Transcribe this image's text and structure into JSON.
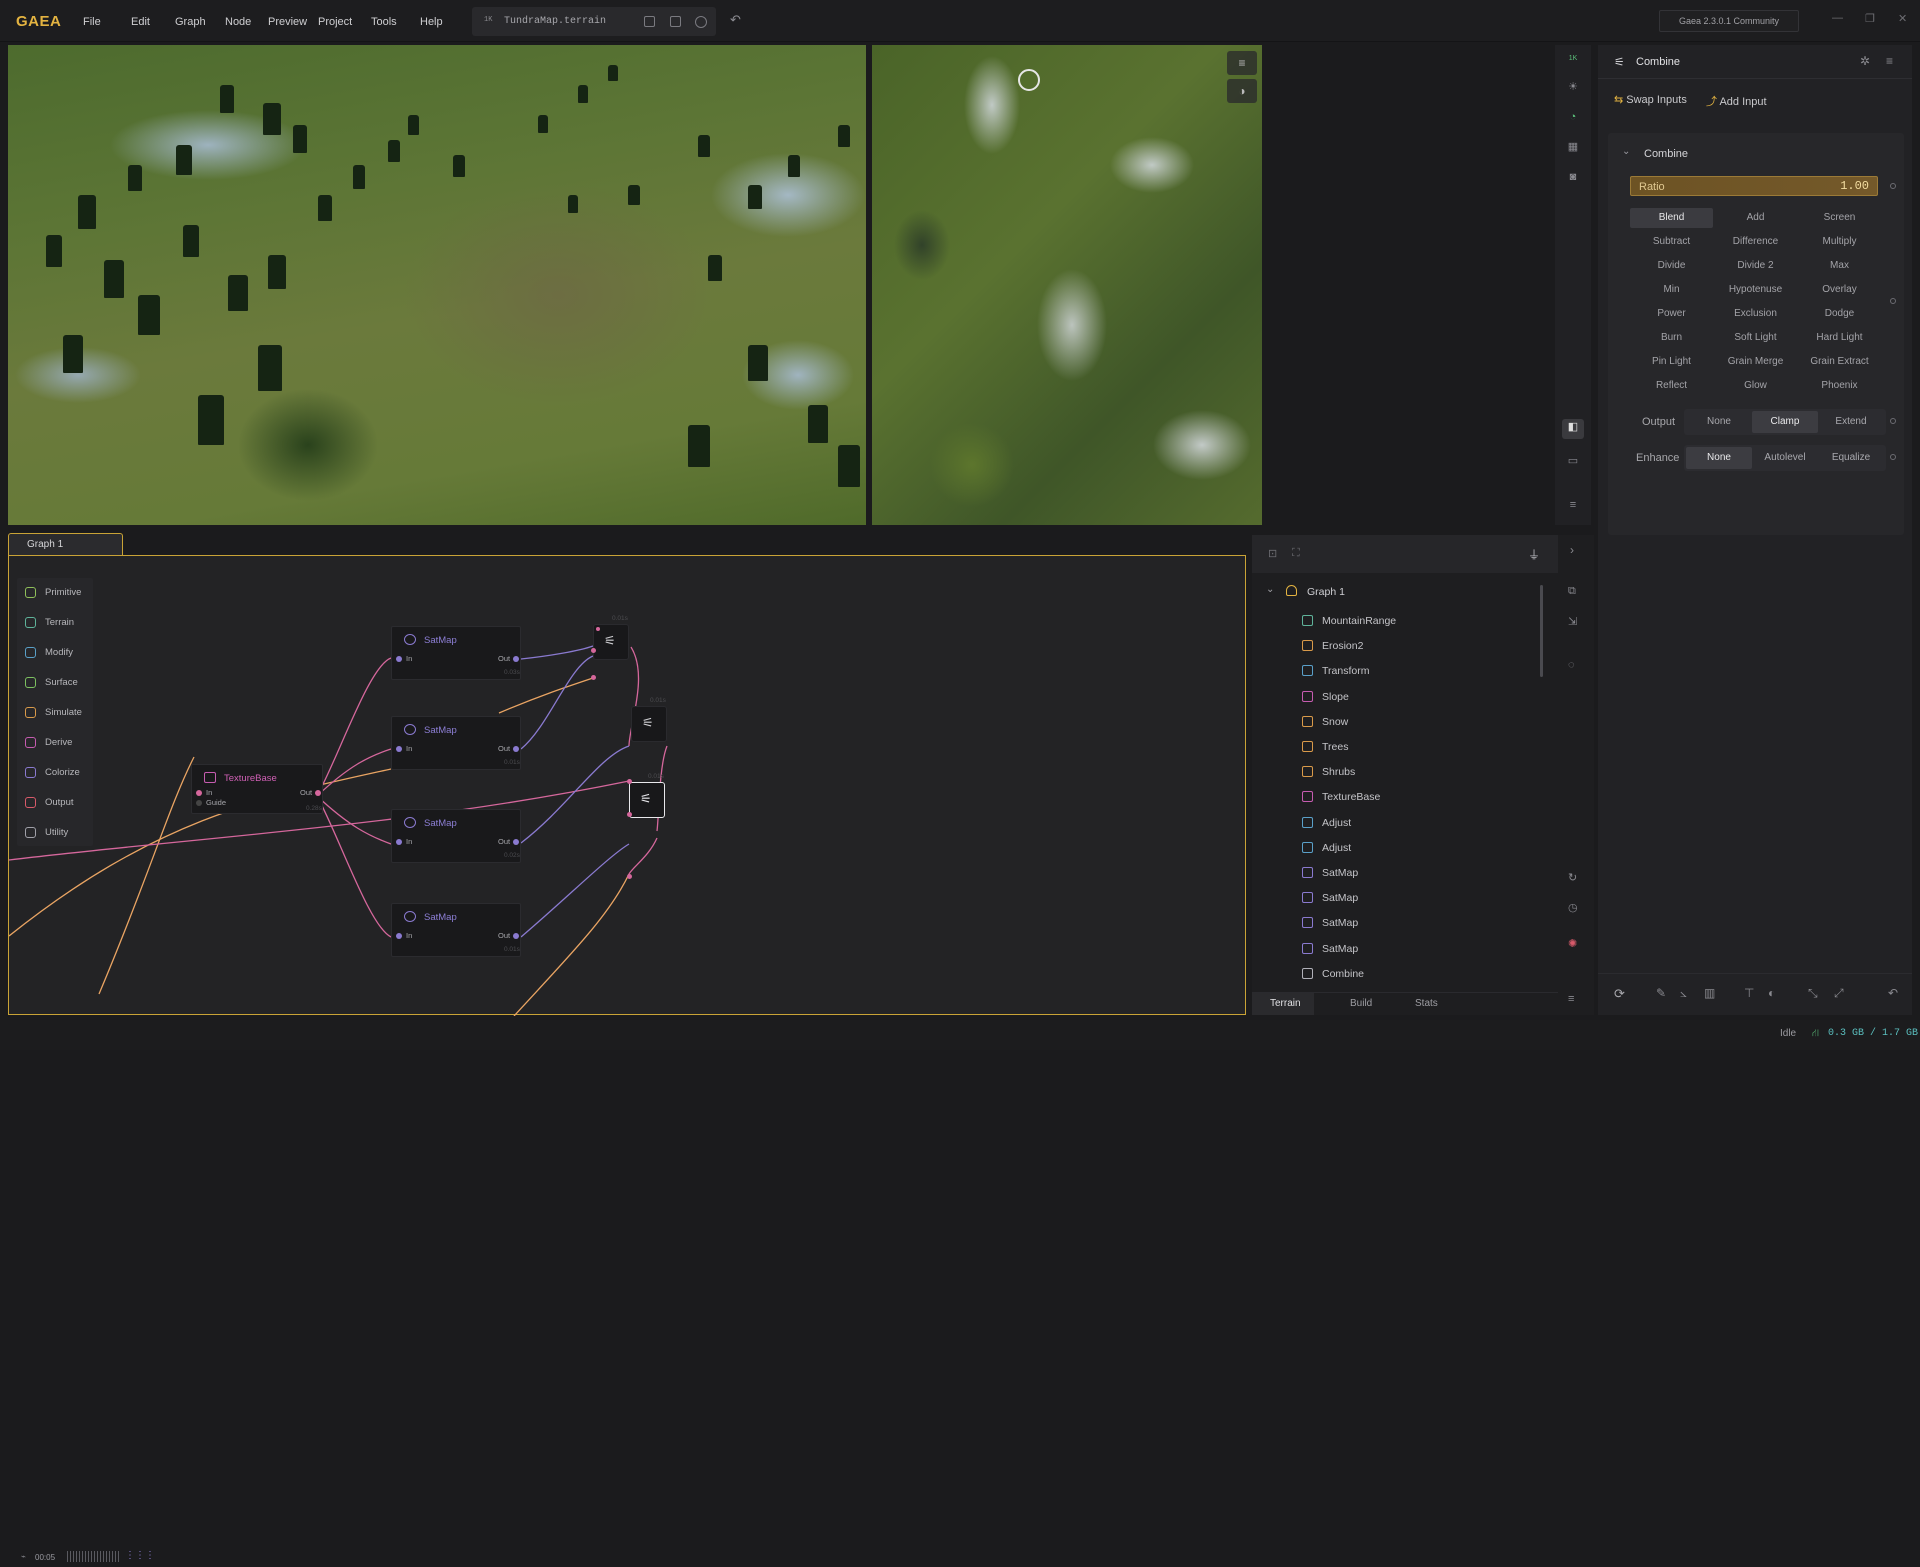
{
  "app": {
    "logo": "GAEA",
    "version": "Gaea 2.3.0.1 Community"
  },
  "menu": [
    "File",
    "Edit",
    "Graph",
    "Node",
    "Preview",
    "Project",
    "Tools",
    "Help"
  ],
  "file": {
    "resolution": "1K",
    "name": "TundraMap.terrain"
  },
  "viewport": {
    "tool_resolution": "1K"
  },
  "props": {
    "node_name": "Combine",
    "swap_inputs": "Swap Inputs",
    "add_input": "Add Input",
    "section_title": "Combine",
    "ratio_label": "Ratio",
    "ratio_value": "1.00",
    "blend_modes": [
      "Blend",
      "Add",
      "Screen",
      "Subtract",
      "Difference",
      "Multiply",
      "Divide",
      "Divide 2",
      "Max",
      "Min",
      "Hypotenuse",
      "Overlay",
      "Power",
      "Exclusion",
      "Dodge",
      "Burn",
      "Soft Light",
      "Hard Light",
      "Pin Light",
      "Grain Merge",
      "Grain Extract",
      "Reflect",
      "Glow",
      "Phoenix"
    ],
    "blend_selected": "Blend",
    "output": {
      "label": "Output",
      "options": [
        "None",
        "Clamp",
        "Extend"
      ],
      "selected": "Clamp"
    },
    "enhance": {
      "label": "Enhance",
      "options": [
        "None",
        "Autolevel",
        "Equalize"
      ],
      "selected": "None"
    }
  },
  "graph": {
    "tab": "Graph 1",
    "palette": [
      {
        "label": "Primitive",
        "color": "#8fbf5a"
      },
      {
        "label": "Terrain",
        "color": "#5fb39a"
      },
      {
        "label": "Modify",
        "color": "#5aa0c8"
      },
      {
        "label": "Surface",
        "color": "#7cc060"
      },
      {
        "label": "Simulate",
        "color": "#d99a4a"
      },
      {
        "label": "Derive",
        "color": "#c65cb0"
      },
      {
        "label": "Colorize",
        "color": "#8a7ad0"
      },
      {
        "label": "Output",
        "color": "#d85a6a"
      },
      {
        "label": "Utility",
        "color": "#a0a0a8"
      }
    ],
    "nodes": {
      "texturebase": {
        "title": "TextureBase",
        "in": "In",
        "guide": "Guide",
        "out": "Out",
        "time": "0.28s"
      },
      "satmaps": [
        {
          "title": "SatMap",
          "in": "In",
          "out": "Out",
          "time": "0.03s"
        },
        {
          "title": "SatMap",
          "in": "In",
          "out": "Out",
          "time": "0.01s"
        },
        {
          "title": "SatMap",
          "in": "In",
          "out": "Out",
          "time": "0.02s"
        },
        {
          "title": "SatMap",
          "in": "In",
          "out": "Out",
          "time": "0.01s"
        }
      ],
      "combine_times": [
        "0.01s",
        "0.01s",
        "0.01s"
      ]
    },
    "timer": "00:05"
  },
  "hierarchy": {
    "root": "Graph 1",
    "items": [
      {
        "label": "MountainRange",
        "color": "#5fb39a"
      },
      {
        "label": "Erosion2",
        "color": "#d99a4a"
      },
      {
        "label": "Transform",
        "color": "#5aa0c8"
      },
      {
        "label": "Slope",
        "color": "#c65cb0"
      },
      {
        "label": "Snow",
        "color": "#d99a4a"
      },
      {
        "label": "Trees",
        "color": "#d99a4a"
      },
      {
        "label": "Shrubs",
        "color": "#d99a4a"
      },
      {
        "label": "TextureBase",
        "color": "#c65cb0"
      },
      {
        "label": "Adjust",
        "color": "#5aa0c8"
      },
      {
        "label": "Adjust",
        "color": "#5aa0c8"
      },
      {
        "label": "SatMap",
        "color": "#8a7ad0"
      },
      {
        "label": "SatMap",
        "color": "#8a7ad0"
      },
      {
        "label": "SatMap",
        "color": "#8a7ad0"
      },
      {
        "label": "SatMap",
        "color": "#8a7ad0"
      },
      {
        "label": "Combine",
        "color": "#b0b0b8"
      }
    ],
    "tabs": [
      "Terrain",
      "Build",
      "Stats"
    ],
    "selected_tab": "Terrain"
  },
  "status": {
    "state": "Idle",
    "memory": "0.3 GB / 1.7 GB"
  }
}
